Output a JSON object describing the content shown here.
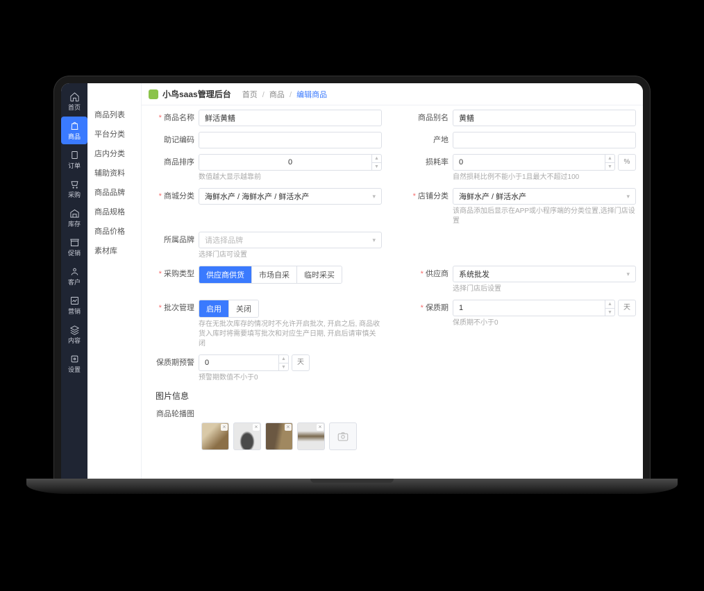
{
  "brand": "小鸟saas管理后台",
  "breadcrumb": {
    "a": "首页",
    "b": "商品",
    "c": "编辑商品"
  },
  "nav": {
    "home": "首页",
    "goods": "商品",
    "order": "订单",
    "purchase": "采购",
    "stock": "库存",
    "promo": "促销",
    "customer": "客户",
    "marketing": "营销",
    "content": "内容",
    "setting": "设置"
  },
  "sub": {
    "i0": "商品列表",
    "i1": "平台分类",
    "i2": "店内分类",
    "i3": "辅助资料",
    "i4": "商品品牌",
    "i5": "商品规格",
    "i6": "商品价格",
    "i7": "素材库"
  },
  "labels": {
    "name": "商品名称",
    "alias": "商品别名",
    "mnemonic": "助记编码",
    "origin": "产地",
    "sort": "商品排序",
    "loss": "损耗率",
    "mall_cat": "商城分类",
    "store_cat": "店铺分类",
    "brand": "所属品牌",
    "purchase_type": "采购类型",
    "supplier": "供应商",
    "batch": "批次管理",
    "shelf": "保质期",
    "warn": "保质期预警",
    "img_section": "图片信息",
    "img_label": "商品轮播图"
  },
  "values": {
    "name": "鲜活黄鳝",
    "alias": "黄鳝",
    "sort": "0",
    "loss": "0",
    "mall_cat": "海鲜水产 / 海鲜水产 / 鲜活水产",
    "store_cat": "海鲜水产 / 鲜活水产",
    "supplier": "系统批发",
    "shelf": "1",
    "warn": "0"
  },
  "placeholders": {
    "brand": "请选择品牌"
  },
  "hints": {
    "sort": "数值越大显示越靠前",
    "loss": "自然损耗比例不能小于1且最大不超过100",
    "store_cat": "该商品添加后显示在APP或小程序端的分类位置,选择门店设置",
    "brand": "选择门店可设置",
    "supplier": "选择门店后设置",
    "batch": "存在无批次库存的情况时不允许开启批次, 开启之后, 商品收货入库时将需要填写批次和对应生产日期, 开启后请审慎关闭",
    "shelf": "保质期不小于0",
    "warn": "预警期数值不小于0"
  },
  "segments": {
    "purchase": {
      "a": "供应商供货",
      "b": "市场自采",
      "c": "临时采买"
    },
    "batch": {
      "on": "启用",
      "off": "关闭"
    }
  },
  "units": {
    "pct": "%",
    "day": "天"
  }
}
